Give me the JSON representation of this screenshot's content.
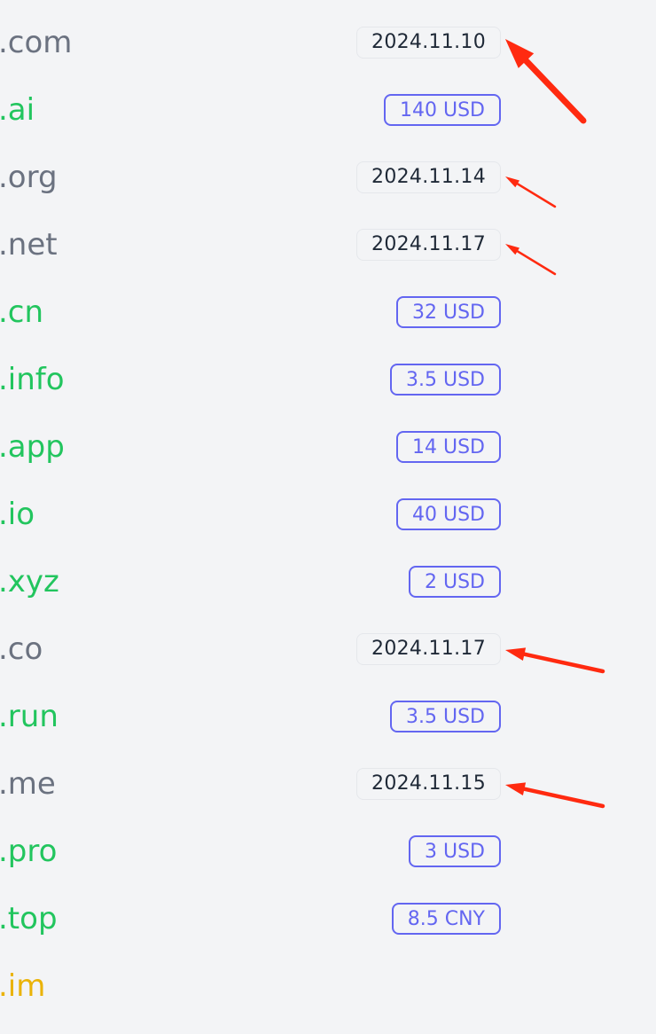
{
  "colors": {
    "taken_tld": "#6b7280",
    "available_tld": "#22c55e",
    "unknown_tld": "#eab308",
    "price_accent": "#6366f1",
    "date_text": "#1f2937",
    "arrow": "#ff2a10",
    "background": "#f3f4f6"
  },
  "rows": [
    {
      "tld": ".com",
      "status": "taken",
      "badge_type": "date",
      "badge": "2024.11.10",
      "arrow": "large"
    },
    {
      "tld": ".ai",
      "status": "available",
      "badge_type": "price",
      "badge": "140 USD"
    },
    {
      "tld": ".org",
      "status": "taken",
      "badge_type": "date",
      "badge": "2024.11.14",
      "arrow": "thin"
    },
    {
      "tld": ".net",
      "status": "taken",
      "badge_type": "date",
      "badge": "2024.11.17",
      "arrow": "thin"
    },
    {
      "tld": ".cn",
      "status": "available",
      "badge_type": "price",
      "badge": "32 USD"
    },
    {
      "tld": ".info",
      "status": "available",
      "badge_type": "price",
      "badge": "3.5 USD"
    },
    {
      "tld": ".app",
      "status": "available",
      "badge_type": "price",
      "badge": "14 USD"
    },
    {
      "tld": ".io",
      "status": "available",
      "badge_type": "price",
      "badge": "40 USD"
    },
    {
      "tld": ".xyz",
      "status": "available",
      "badge_type": "price",
      "badge": "2 USD"
    },
    {
      "tld": ".co",
      "status": "taken",
      "badge_type": "date",
      "badge": "2024.11.17",
      "arrow": "medium"
    },
    {
      "tld": ".run",
      "status": "available",
      "badge_type": "price",
      "badge": "3.5 USD"
    },
    {
      "tld": ".me",
      "status": "taken",
      "badge_type": "date",
      "badge": "2024.11.15",
      "arrow": "medium"
    },
    {
      "tld": ".pro",
      "status": "available",
      "badge_type": "price",
      "badge": "3 USD"
    },
    {
      "tld": ".top",
      "status": "available",
      "badge_type": "price",
      "badge": "8.5 CNY"
    },
    {
      "tld": ".im",
      "status": "unknown",
      "badge_type": "none",
      "badge": ""
    }
  ]
}
